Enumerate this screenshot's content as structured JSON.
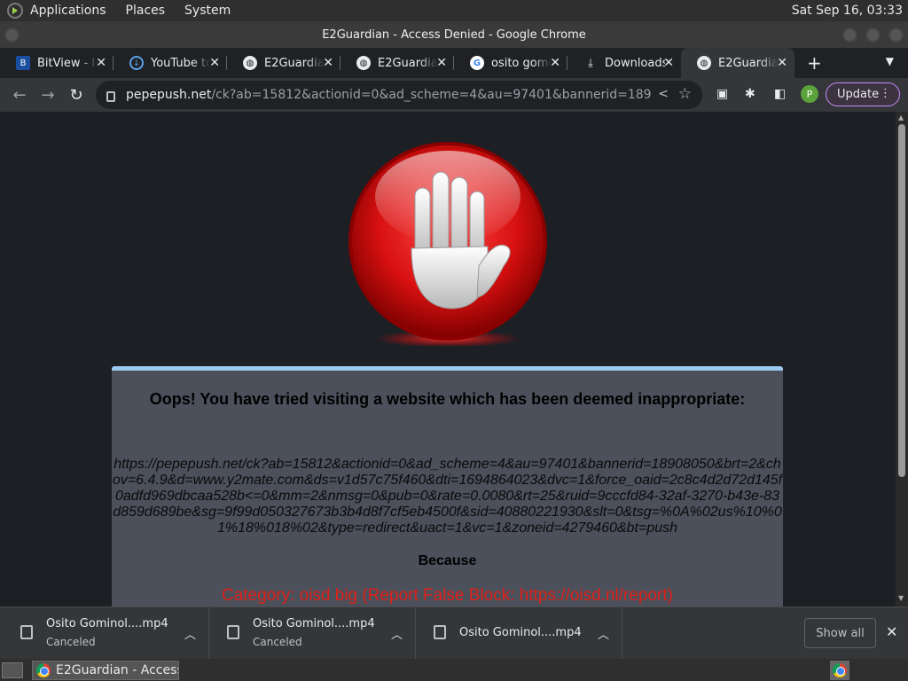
{
  "os_panel": {
    "menus": [
      "Applications",
      "Places",
      "System"
    ],
    "clock": "Sat Sep 16, 03:33"
  },
  "window": {
    "title": "E2Guardian - Access Denied - Google Chrome"
  },
  "tabs": [
    {
      "label": "BitView - Int",
      "icon": "bitview-icon",
      "active": false
    },
    {
      "label": "YouTube to",
      "icon": "download-cloud-icon",
      "active": false
    },
    {
      "label": "E2Guardian",
      "icon": "globe-icon",
      "active": false
    },
    {
      "label": "E2Guardian",
      "icon": "globe-icon",
      "active": false
    },
    {
      "label": "osito gomi",
      "icon": "google-icon",
      "active": false
    },
    {
      "label": "Downloads",
      "icon": "download-icon",
      "active": false
    },
    {
      "label": "E2Guardian",
      "icon": "globe-icon",
      "active": true
    }
  ],
  "toolbar": {
    "url_domain": "pepepush.net",
    "url_path": "/ck?ab=15812&actionid=0&ad_scheme=4&au=97401&bannerid=18908050&br...",
    "avatar_letter": "P",
    "update_label": "Update"
  },
  "page": {
    "heading": "Oops! You have tried visiting a website which has been deemed inappropriate:",
    "blocked_url": "https://pepepush.net/ck?ab=15812&actionid=0&ad_scheme=4&au=97401&bannerid=18908050&brt=2&chov=6.4.9&d=www.y2mate.com&ds=v1d57c75f460&dti=1694864023&dvc=1&force_oaid=2c8c4d2d72d145f0adfd969dbcaa528b<=0&mm=2&nmsg=0&pub=0&rate=0.0080&rt=25&ruid=9cccfd84-32af-3270-b43e-83d859d689be&sg=9f99d050327673b3b4d8f7cf5eb4500f&sid=40880221930&slt=0&tsg=%0A%02us%10%01%18%018%02&type=redirect&uact=1&vc=1&zoneid=4279460&bt=push",
    "because_label": "Because",
    "category": "Category: oisd big (Report False Block: https://oisd.nl/report)"
  },
  "downloads": [
    {
      "name": "Osito Gominol....mp4",
      "status": "Canceled"
    },
    {
      "name": "Osito Gominol....mp4",
      "status": "Canceled"
    },
    {
      "name": "Osito Gominol....mp4",
      "status": ""
    }
  ],
  "download_shelf": {
    "show_all_label": "Show all"
  },
  "taskbar": {
    "task_label": "E2Guardian - Access..."
  },
  "colors": {
    "page_bg": "#1c1f24",
    "panel_bg": "#4b505b",
    "panel_border": "#9cc8f0",
    "category_text": "#e0201a",
    "update_border": "#c58af9"
  }
}
